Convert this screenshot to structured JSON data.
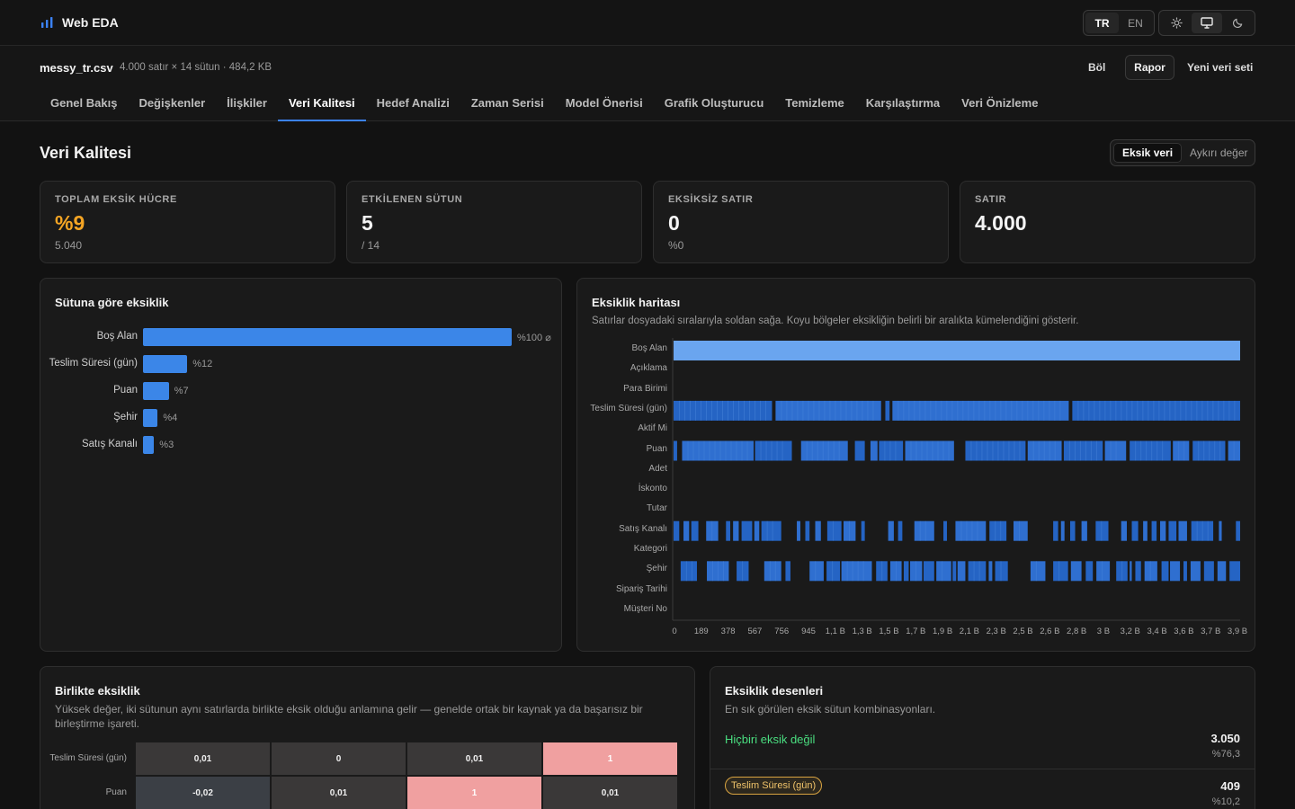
{
  "app": {
    "title": "Web EDA",
    "brand_color": "#3b82f6"
  },
  "lang": {
    "tr": "TR",
    "en": "EN",
    "active": "TR"
  },
  "theme": {
    "icons": [
      "sun-icon",
      "monitor-icon",
      "moon-icon"
    ],
    "active": "monitor-icon"
  },
  "file": {
    "name": "messy_tr.csv",
    "meta": "4.000 satır × 14 sütun · 484,2 KB"
  },
  "actions": {
    "split": "Böl",
    "report": "Rapor",
    "new_dataset": "Yeni veri seti"
  },
  "tabs": [
    {
      "label": "Genel Bakış"
    },
    {
      "label": "Değişkenler"
    },
    {
      "label": "İlişkiler"
    },
    {
      "label": "Veri Kalitesi",
      "active": true
    },
    {
      "label": "Hedef Analizi"
    },
    {
      "label": "Zaman Serisi"
    },
    {
      "label": "Model Önerisi"
    },
    {
      "label": "Grafik Oluşturucu"
    },
    {
      "label": "Temizleme"
    },
    {
      "label": "Karşılaştırma"
    },
    {
      "label": "Veri Önizleme"
    }
  ],
  "page": {
    "title": "Veri Kalitesi",
    "segment": {
      "missing": "Eksik veri",
      "outlier": "Aykırı değer",
      "active": "missing"
    }
  },
  "stats": [
    {
      "label": "TOPLAM EKSİK HÜCRE",
      "value": "%9",
      "sub": "5.040",
      "accent": "#f5a524"
    },
    {
      "label": "ETKİLENEN SÜTUN",
      "value": "5",
      "sub": "/ 14"
    },
    {
      "label": "EKSİKSİZ SATIR",
      "value": "0",
      "sub": "%0"
    },
    {
      "label": "SATIR",
      "value": "4.000",
      "sub": ""
    }
  ],
  "missing_by_column": {
    "title": "Sütuna göre eksiklik",
    "chart_data": {
      "type": "bar",
      "orientation": "horizontal",
      "categories": [
        "Boş Alan",
        "Teslim Süresi (gün)",
        "Puan",
        "Şehir",
        "Satış Kanalı"
      ],
      "values": [
        100,
        12,
        7,
        4,
        3
      ],
      "value_labels": [
        "%100 ⌀",
        "%12",
        "%7",
        "%4",
        "%3"
      ],
      "unit": "%",
      "color": "#3b86e8"
    }
  },
  "missing_map": {
    "title": "Eksiklik haritası",
    "desc": "Satırlar dosyadaki sıralarıyla soldan sağa. Koyu bölgeler eksikliğin belirli bir aralıkta kümelendiğini gösterir.",
    "rows": [
      "Boş Alan",
      "Açıklama",
      "Para Birimi",
      "Teslim Süresi (gün)",
      "Aktif Mi",
      "Puan",
      "Adet",
      "İskonto",
      "Tutar",
      "Satış Kanalı",
      "Kategori",
      "Şehir",
      "Sipariş Tarihi",
      "Müşteri No"
    ],
    "x_ticks": [
      "0",
      "189",
      "378",
      "567",
      "756",
      "945",
      "1,1 B",
      "1,3 B",
      "1,5 B",
      "1,7 B",
      "1,9 B",
      "2,1 B",
      "2,3 B",
      "2,5 B",
      "2,6 B",
      "2,8 B",
      "3 B",
      "3,2 B",
      "3,4 B",
      "3,6 B",
      "3,7 B",
      "3,9 B"
    ],
    "chart_data": {
      "type": "heatmap",
      "x_range": [
        0,
        4000
      ],
      "series": [
        {
          "name": "Boş Alan",
          "missing_ranges": [
            [
              0,
              4000
            ]
          ]
        },
        {
          "name": "Teslim Süresi (gün)",
          "missing_ranges": [
            [
              0,
              695
            ],
            [
              720,
              1465
            ],
            [
              1495,
              1525
            ],
            [
              1545,
              2790
            ],
            [
              2815,
              4000
            ]
          ]
        },
        {
          "name": "Puan",
          "missing_ranges": [
            [
              0,
              25
            ],
            [
              60,
              565
            ],
            [
              575,
              835
            ],
            [
              900,
              1230
            ],
            [
              1280,
              1350
            ],
            [
              1390,
              1440
            ],
            [
              1450,
              1620
            ],
            [
              1635,
              1980
            ],
            [
              2060,
              2485
            ],
            [
              2500,
              2740
            ],
            [
              2755,
              3030
            ],
            [
              3045,
              3195
            ],
            [
              3220,
              3510
            ],
            [
              3525,
              3640
            ],
            [
              3665,
              3895
            ],
            [
              3915,
              4000
            ]
          ]
        },
        {
          "name": "Satış Kanalı",
          "missing_ranges": [
            [
              0,
              40
            ],
            [
              70,
              110
            ],
            [
              125,
              175
            ],
            [
              230,
              315
            ],
            [
              370,
              400
            ],
            [
              420,
              460
            ],
            [
              480,
              555
            ],
            [
              570,
              605
            ],
            [
              620,
              760
            ],
            [
              870,
              895
            ],
            [
              930,
              960
            ],
            [
              1000,
              1040
            ],
            [
              1085,
              1185
            ],
            [
              1200,
              1285
            ],
            [
              1325,
              1350
            ],
            [
              1515,
              1555
            ],
            [
              1585,
              1615
            ],
            [
              1700,
              1840
            ],
            [
              1905,
              1930
            ],
            [
              1990,
              2205
            ],
            [
              2230,
              2350
            ],
            [
              2400,
              2500
            ],
            [
              2680,
              2715
            ],
            [
              2735,
              2760
            ],
            [
              2800,
              2835
            ],
            [
              2880,
              2920
            ],
            [
              2980,
              3070
            ],
            [
              3160,
              3200
            ],
            [
              3235,
              3280
            ],
            [
              3315,
              3345
            ],
            [
              3375,
              3410
            ],
            [
              3435,
              3475
            ],
            [
              3495,
              3550
            ],
            [
              3565,
              3625
            ],
            [
              3655,
              3810
            ],
            [
              3850,
              3870
            ],
            [
              3970,
              4000
            ]
          ]
        },
        {
          "name": "Şehir",
          "missing_ranges": [
            [
              50,
              165
            ],
            [
              235,
              390
            ],
            [
              445,
              530
            ],
            [
              640,
              760
            ],
            [
              790,
              825
            ],
            [
              960,
              1060
            ],
            [
              1080,
              1175
            ],
            [
              1185,
              1400
            ],
            [
              1430,
              1510
            ],
            [
              1530,
              1610
            ],
            [
              1625,
              1660
            ],
            [
              1670,
              1755
            ],
            [
              1765,
              1840
            ],
            [
              1855,
              1960
            ],
            [
              1970,
              1995
            ],
            [
              2005,
              2060
            ],
            [
              2080,
              2205
            ],
            [
              2225,
              2250
            ],
            [
              2270,
              2360
            ],
            [
              2520,
              2625
            ],
            [
              2680,
              2785
            ],
            [
              2805,
              2880
            ],
            [
              2910,
              2960
            ],
            [
              2985,
              3080
            ],
            [
              3125,
              3205
            ],
            [
              3220,
              3235
            ],
            [
              3260,
              3300
            ],
            [
              3325,
              3415
            ],
            [
              3445,
              3495
            ],
            [
              3505,
              3575
            ],
            [
              3600,
              3625
            ],
            [
              3650,
              3720
            ],
            [
              3745,
              3815
            ],
            [
              3840,
              3900
            ],
            [
              3925,
              4000
            ]
          ]
        }
      ]
    }
  },
  "co_missing": {
    "title": "Birlikte eksiklik",
    "desc": "Yüksek değer, iki sütunun aynı satırlarda birlikte eksik olduğu anlamına gelir — genelde ortak bir kaynak ya da başarısız bir birleştirme işareti.",
    "chart_data": {
      "type": "heatmap",
      "rows": [
        "Teslim Süresi (gün)",
        "Puan"
      ],
      "values": [
        [
          "0,01",
          "0",
          "0,01",
          "1"
        ],
        [
          "-0,02",
          "0,01",
          "1",
          "0,01"
        ]
      ]
    }
  },
  "patterns": {
    "title": "Eksiklik desenleri",
    "desc": "En sık görülen eksik sütun kombinasyonları.",
    "items": [
      {
        "label": "Hiçbiri eksik değil",
        "count": "3.050",
        "pct": "%76,3",
        "kind": "none"
      },
      {
        "label": "Teslim Süresi (gün)",
        "count": "409",
        "pct": "%10,2",
        "kind": "chip"
      }
    ]
  }
}
